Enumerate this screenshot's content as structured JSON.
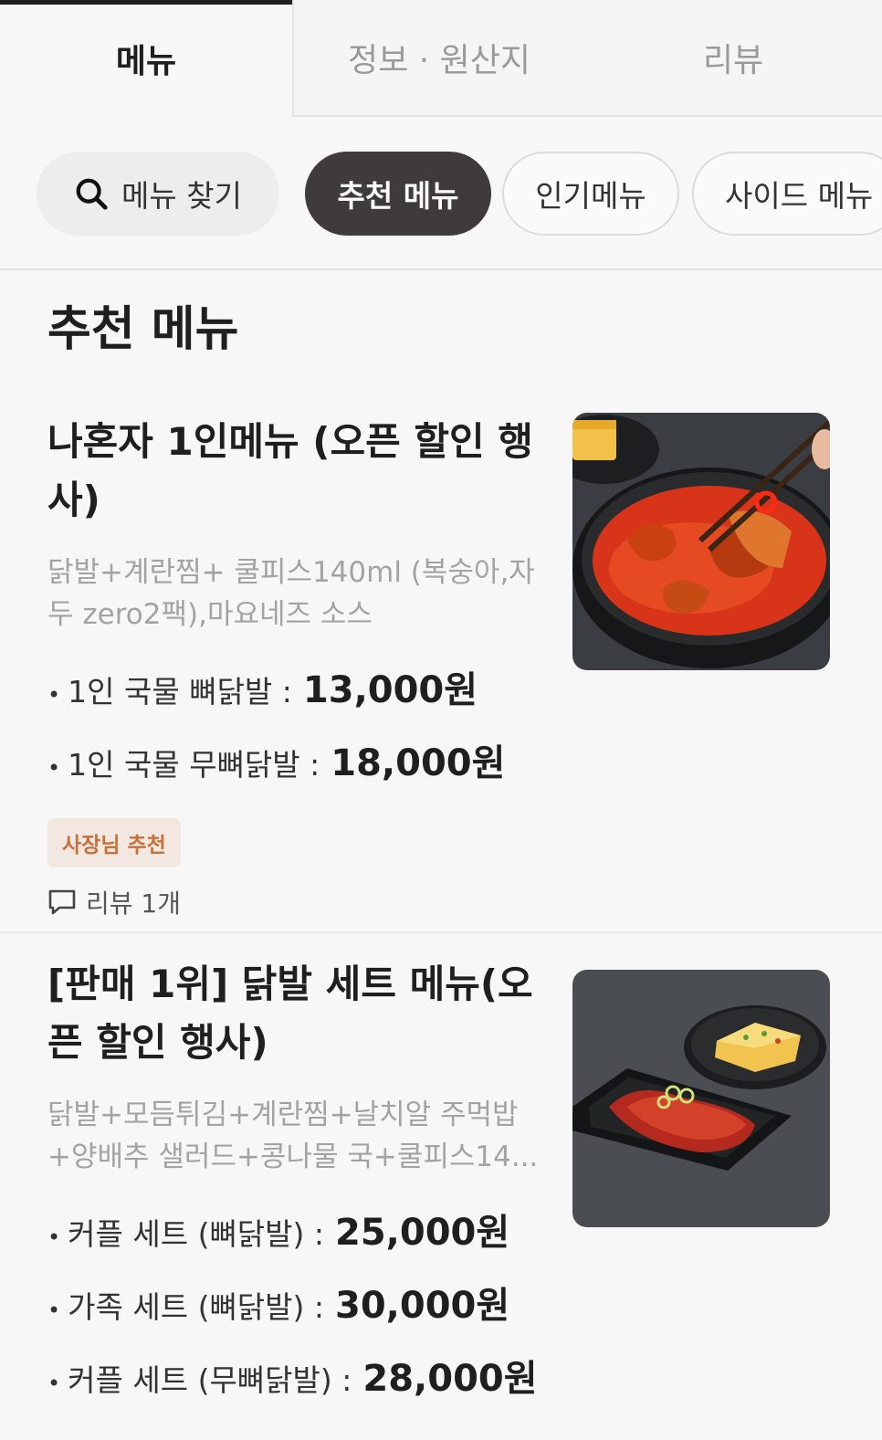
{
  "tabs": [
    {
      "label": "메뉴",
      "active": true
    },
    {
      "label": "정보 · 원산지",
      "active": false
    },
    {
      "label": "리뷰",
      "active": false
    }
  ],
  "chips": {
    "search_label": "메뉴 찾기",
    "items": [
      {
        "label": "추천 메뉴",
        "active": true
      },
      {
        "label": "인기메뉴",
        "active": false
      },
      {
        "label": "사이드 메뉴",
        "active": false
      }
    ]
  },
  "section": {
    "title": "추천 메뉴",
    "items": [
      {
        "title": "나혼자 1인메뉴 (오픈 할인 행사)",
        "description": "닭발+계란찜+ 쿨피스140ml (복숭아,자두 zero2팩),마요네즈 소스",
        "prices": [
          {
            "label": "1인 국물  뼈닭발 :",
            "price": "13,000원"
          },
          {
            "label": "1인 국물 무뼈닭발 :",
            "price": "18,000원"
          }
        ],
        "badge": "사장님 추천",
        "review": "리뷰 1개",
        "image": "spicy-chicken-feet-soup-photo"
      },
      {
        "title": "[판매 1위]  닭발 세트 메뉴(오픈 할인 행사)",
        "description": "닭발+모듬튀김+계란찜+날치알 주먹밥+양배추 샐러드+콩나물 국+쿨피스14...",
        "prices": [
          {
            "label": "커플 세트 (뼈닭발) :",
            "price": "25,000원"
          },
          {
            "label": "가족 세트 (뼈닭발) :",
            "price": "30,000원"
          },
          {
            "label": "커플 세트 (무뼈닭발) :",
            "price": "28,000원"
          }
        ],
        "image": "chicken-feet-set-photo"
      }
    ]
  },
  "colors": {
    "active_chip": "#3f3b3c",
    "badge_bg": "#f3e8e1",
    "badge_text": "#c8703a",
    "background": "#f7f7f7"
  }
}
